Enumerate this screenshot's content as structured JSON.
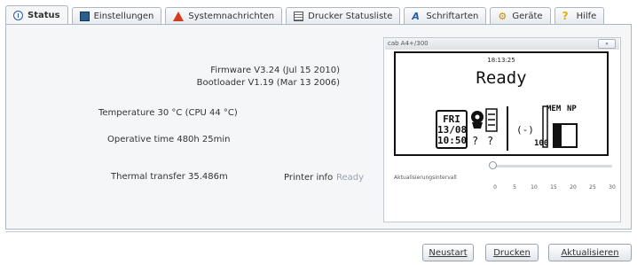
{
  "tabs": [
    {
      "label": "Status",
      "icon": "info-icon"
    },
    {
      "label": "Einstellungen",
      "icon": "settings-icon"
    },
    {
      "label": "Systemnachrichten",
      "icon": "warning-icon"
    },
    {
      "label": "Drucker Statusliste",
      "icon": "list-icon"
    },
    {
      "label": "Schriftarten",
      "icon": "font-icon"
    },
    {
      "label": "Geräte",
      "icon": "device-icon"
    },
    {
      "label": "Hilfe",
      "icon": "help-icon"
    }
  ],
  "status": {
    "firmware": "Firmware V3.24 (Jul 15 2010)",
    "bootloader": "Bootloader V1.19 (Mar 13 2006)",
    "temperature": "Temperature 30 °C (CPU 44 °C)",
    "operative_time": "Operative time 480h 25min",
    "thermal_transfer": "Thermal transfer 35.486m",
    "printer_info_label": "Printer info",
    "printer_info_value": "Ready"
  },
  "preview": {
    "window_title": "cab A4+/300",
    "button_label": "«",
    "lcd_time": "18:13:25",
    "lcd_status": "Ready",
    "lcd_date_lines": [
      "FRI",
      "13/08",
      "10:50"
    ],
    "lcd_q1": "?",
    "lcd_q2": "?",
    "lcd_arrow": "(-)",
    "lcd_count": "100",
    "lcd_mem": "MEM",
    "lcd_np": "NP",
    "slider_label": "Aktualisierungsintervall",
    "slider_value": 0,
    "slider_ticks": [
      "0",
      "5",
      "10",
      "15",
      "20",
      "25",
      "30"
    ]
  },
  "buttons": {
    "restart": "Neustart",
    "print": "Drucken",
    "refresh": "Aktualisieren"
  },
  "colors": {
    "tab_border": "#aeb6c1",
    "panel_bg": "#f4f6f8",
    "info_status": "#9aa3ae"
  }
}
